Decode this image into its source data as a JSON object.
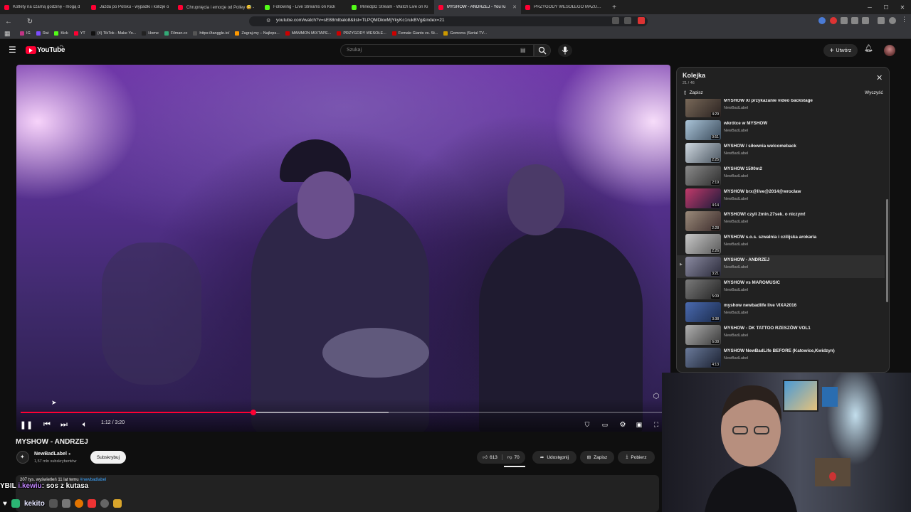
{
  "browser": {
    "tabs": [
      {
        "label": "Kotlety na czarną godzinę - mogą d",
        "icon": "youtube",
        "active": false
      },
      {
        "label": "Jazda po Polsku - wypadki i kolizje o",
        "icon": "youtube",
        "active": false
      },
      {
        "label": "Chrupnięcia i emocje od Polley 😅 -",
        "icon": "youtube",
        "active": false
      },
      {
        "label": "Following - Live Streams on Kick",
        "icon": "kick",
        "active": false
      },
      {
        "label": "Minedpl2 Stream - Watch Live on Ki",
        "icon": "kick",
        "active": false
      },
      {
        "label": "MYSHOW - ANDRZEJ - YouTu",
        "icon": "youtube",
        "active": true
      },
      {
        "label": "PRZYGODY WESOŁEGO MAZURA w",
        "icon": "youtube",
        "active": false
      }
    ],
    "url": "youtube.com/watch?v=sE88mlbalo8&list=TLPQMDkwMjYkyKc1rukBVg&index=21",
    "bookmarks": [
      "IG",
      "Rat",
      "Kick",
      "YT",
      "(4) TikTok - Make Yo...",
      "Home",
      "Filman.cc",
      "https://tanggle.io/",
      "Zagraj.my – Najleps...",
      "MAMMON MIXTAPE...",
      "PRZYGODY WESOŁE...",
      "Female Giants vs. St...",
      "Gomorra (Serial TV..."
    ]
  },
  "youtube": {
    "logo": "YouTube",
    "country": "PL",
    "search_placeholder": "Szukaj",
    "create_label": "Utwórz"
  },
  "player": {
    "time": "1:12 / 3:20",
    "progress_fraction": 0.36,
    "buffered_fraction": 0.57
  },
  "video": {
    "title": "MYSHOW - ANDRZEJ",
    "channel": "NewBadLabel",
    "subscribers": "1,57 mln subskrybentów",
    "subscribe_label": "Subskrybuj",
    "likes": "613",
    "dislikes": "70",
    "share_label": "Udostępnij",
    "save_label": "Zapisz",
    "download_label": "Pobierz",
    "meta": "207 tys. wyświetleń  11 lat temu",
    "hashtag": "#newbadlabel"
  },
  "overlay": {
    "prefix": "YBIL",
    "handle": "i.kewiu",
    "message": ": sos z kutasa",
    "kekito": "kekito"
  },
  "queue": {
    "title": "Kolejka",
    "count": "21 / 46",
    "save_label": "Zapisz",
    "clear_label": "Wyczyść",
    "items": [
      {
        "title": "MYSHOW XI przykazanie video backstage",
        "channel": "NewBadLabel",
        "duration": "4:29",
        "current": false
      },
      {
        "title": "wkrótce w MYSHOW",
        "channel": "NewBadLabel",
        "duration": "0:51",
        "current": false
      },
      {
        "title": "MYSHOW / siłownia welcomeback",
        "channel": "NewBadLabel",
        "duration": "2:25",
        "current": false
      },
      {
        "title": "MYSHOW 1500m2",
        "channel": "NewBadLabel",
        "duration": "2:19",
        "current": false
      },
      {
        "title": "MYSHOW brx@live@2014@wrocław",
        "channel": "NewBadLabel",
        "duration": "4:14",
        "current": false
      },
      {
        "title": "MYSHOW! czyli 2min.27sek. o niczym!",
        "channel": "NewBadLabel",
        "duration": "2:28",
        "current": false
      },
      {
        "title": "MYSHOW s.o.s. szwalnia i czilijska arokaria",
        "channel": "NewBadLabel",
        "duration": "2:26",
        "current": false
      },
      {
        "title": "MYSHOW - ANDRZEJ",
        "channel": "NewBadLabel",
        "duration": "3:21",
        "current": true
      },
      {
        "title": "MYSHOW vs MAROMUSIC",
        "channel": "NewBadLabel",
        "duration": "5:09",
        "current": false
      },
      {
        "title": "myshow newbadlife live VIXA2016",
        "channel": "NewBadLabel",
        "duration": "3:38",
        "current": false
      },
      {
        "title": "MYSHOW - DK TATTOO RZESZÓW VOL1",
        "channel": "NewBadLabel",
        "duration": "6:08",
        "current": false
      },
      {
        "title": "MYSHOW NewBadLife BEFORE (Katowice,Kwidzyn)",
        "channel": "NewBadLabel",
        "duration": "4:13",
        "current": false
      }
    ]
  },
  "colors": {
    "accent": "#ff0033",
    "kick": "#53fc18",
    "background": "#0f0f0f"
  }
}
